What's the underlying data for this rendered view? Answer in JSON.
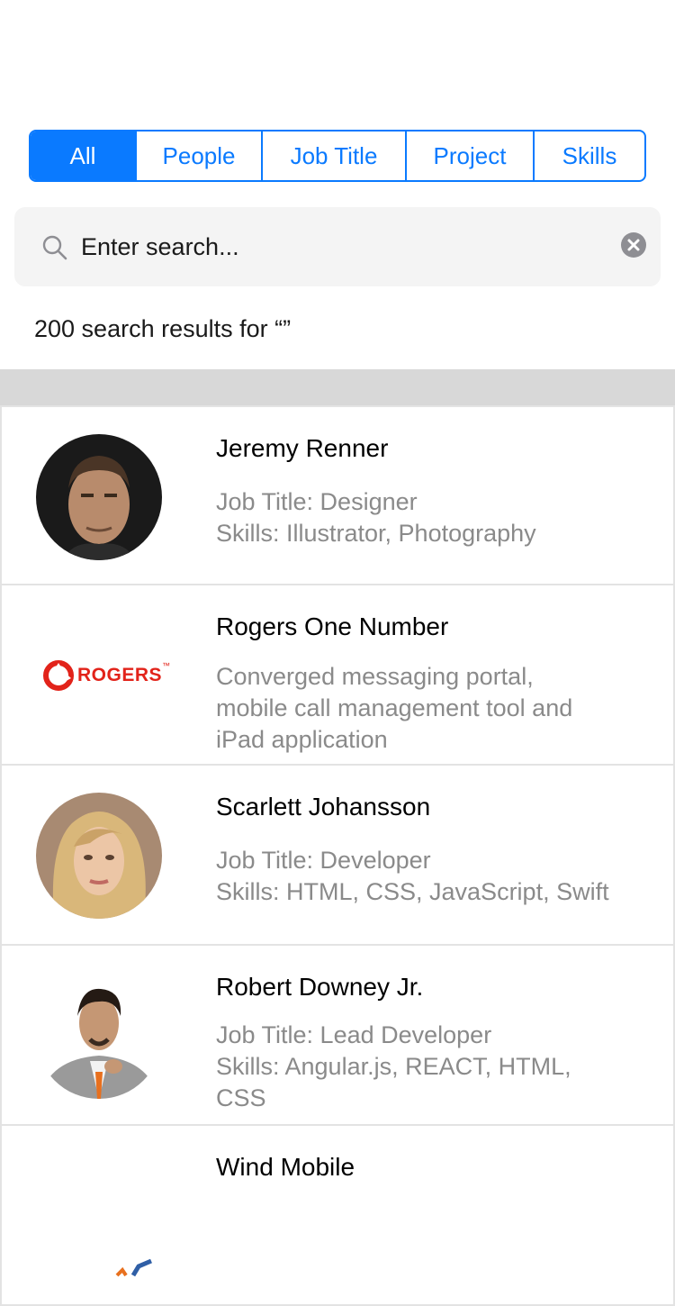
{
  "tabs": [
    {
      "label": "All",
      "active": true
    },
    {
      "label": "People",
      "active": false
    },
    {
      "label": "Job Title",
      "active": false
    },
    {
      "label": "Project",
      "active": false
    },
    {
      "label": "Skills",
      "active": false
    }
  ],
  "search": {
    "placeholder": "Enter search...",
    "value": ""
  },
  "results_summary": "200 search results for “”",
  "results": [
    {
      "title": "Jeremy Renner",
      "line1": "Job Title: Designer",
      "line2": "Skills: Illustrator, Photography",
      "image": "person-photo-jeremy-renner"
    },
    {
      "title": "Rogers One Number",
      "line1": "Converged messaging portal,",
      "line2": "mobile call management tool and",
      "line3": "iPad application",
      "logo_text": "ROGERS",
      "logo_mark": "™",
      "image": "rogers-logo"
    },
    {
      "title": "Scarlett Johansson",
      "line1": "Job Title: Developer",
      "line2": "Skills: HTML, CSS, JavaScript, Swift",
      "image": "person-photo-scarlett-johansson"
    },
    {
      "title": "Robert Downey Jr.",
      "line1": "Job Title: Lead Developer",
      "line2": "Skills: Angular.js, REACT, HTML,",
      "line3": "CSS",
      "image": "person-photo-robert-downey-jr"
    },
    {
      "title": "Wind Mobile",
      "image": "wind-mobile-logo"
    }
  ],
  "colors": {
    "accent": "#0a7aff",
    "secondary_text": "#8a8a8a",
    "search_bg": "#f4f4f4",
    "band": "#d8d8d8",
    "rogers_red": "#e2231a"
  }
}
